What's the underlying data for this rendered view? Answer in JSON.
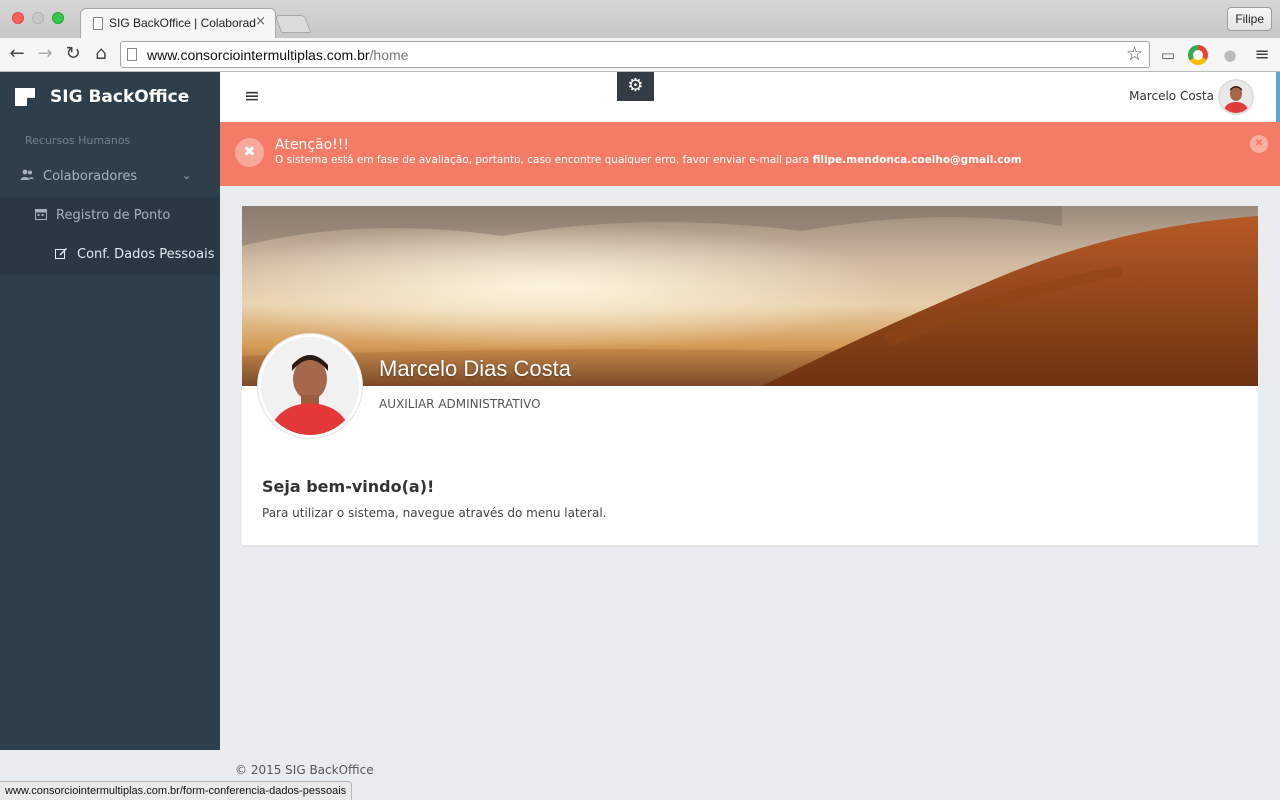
{
  "browser": {
    "tab_title": "SIG BackOffice | Colaborad",
    "tab_close": "×",
    "profile_label": "Filipe",
    "url_host": "www.consorciointermultiplas.com.br",
    "url_path": "/home",
    "status_url": "www.consorciointermultiplas.com.br/form-conferencia-dados-pessoais"
  },
  "sidebar": {
    "brand": "SIG BackOffice",
    "section": "Recursos Humanos",
    "items": [
      {
        "label": "Colaboradores",
        "icon": "users-icon"
      },
      {
        "label": "Registro de Ponto",
        "icon": "calendar-icon"
      },
      {
        "label": "Conf. Dados Pessoais",
        "icon": "edit-icon"
      }
    ]
  },
  "topbar": {
    "user_name": "Marcelo Costa"
  },
  "alert": {
    "title": "Atenção!!!",
    "message": "O sistema está em fase de avaliação, portanto, caso encontre qualquer erro, favor enviar e-mail para ",
    "email": "filipe.mendonca.coelho@gmail.com"
  },
  "profile": {
    "name": "Marcelo Dias Costa",
    "role": "AUXILIAR ADMINISTRATIVO"
  },
  "welcome": {
    "title": "Seja bem-vindo(a)!",
    "text": "Para utilizar o sistema, navegue através do menu lateral."
  },
  "footer": {
    "copyright": "© 2015 SIG BackOffice"
  },
  "colors": {
    "sidebar": "#2f3e4b",
    "alert": "#f47b65",
    "accent": "#5aa6d6"
  }
}
